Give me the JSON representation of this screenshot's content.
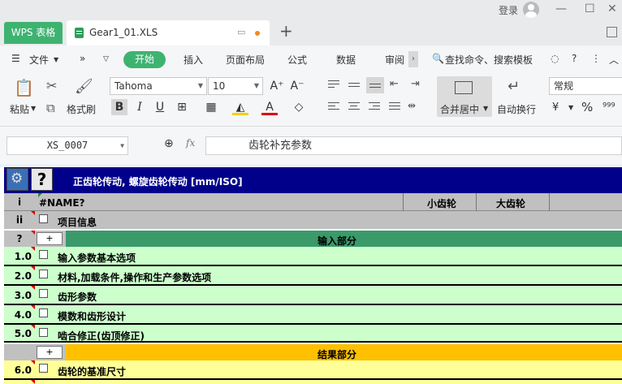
{
  "titlebar": {
    "app_tab": "WPS 表格",
    "file_tab": "Gear1_01.XLS",
    "login": "登录"
  },
  "menu": {
    "file": "文件",
    "items": [
      "开始",
      "插入",
      "页面布局",
      "公式",
      "数据",
      "审阅"
    ],
    "search": "查找命令、搜索模板"
  },
  "ribbon": {
    "paste": "粘贴",
    "format_painter": "格式刷",
    "font_name": "Tahoma",
    "font_size": "10",
    "merge_center": "合并居中",
    "wrap_text": "自动换行",
    "number_format": "常规"
  },
  "formula_bar": {
    "name_box": "XS_0007",
    "fx": "fx",
    "content": "齿轮补充参数"
  },
  "sheet": {
    "header_title": "正齿轮传动, 螺旋齿轮传动 [mm/ISO]",
    "col_header": {
      "idx": "i",
      "name": "#NAME?",
      "pinion": "小齿轮",
      "gear": "大齿轮"
    },
    "info_row": {
      "idx": "ii",
      "label": "项目信息"
    },
    "input_section": {
      "idx": "?",
      "plus": "+",
      "title": "输入部分"
    },
    "input_rows": [
      {
        "idx": "1.0",
        "label": "输入参数基本选项"
      },
      {
        "idx": "2.0",
        "label": "材料,加载条件,操作和生产参数选项"
      },
      {
        "idx": "3.0",
        "label": "齿形参数"
      },
      {
        "idx": "4.0",
        "label": "模数和齿形设计"
      },
      {
        "idx": "5.0",
        "label": "啮合修正(齿顶修正)"
      }
    ],
    "result_section": {
      "plus": "+",
      "title": "结果部分"
    },
    "result_rows": [
      {
        "idx": "6.0",
        "label": "齿轮的基准尺寸"
      }
    ]
  },
  "colors": {
    "wps_green": "#3eb370",
    "header_blue": "#00008b",
    "input_green": "#3a9a6a",
    "input_light": "#ccffcc",
    "result_orange": "#ffc000",
    "result_light": "#ffff99"
  }
}
